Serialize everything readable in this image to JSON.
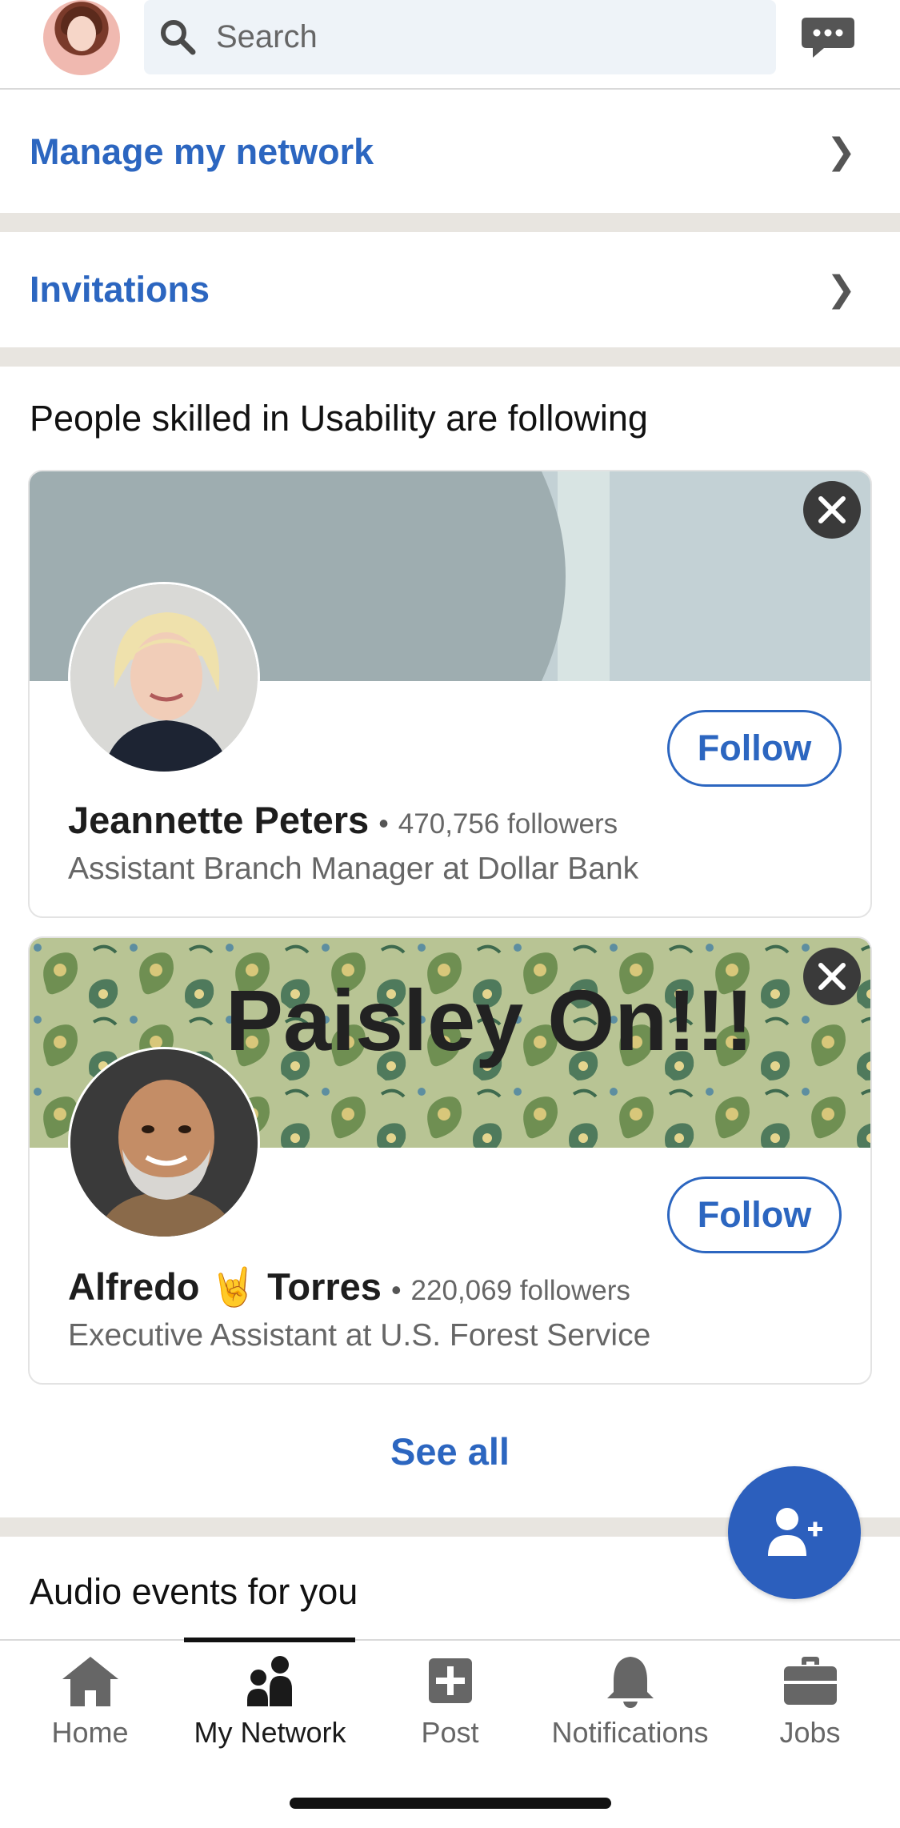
{
  "header": {
    "search_placeholder": "Search"
  },
  "rows": {
    "manage_network": "Manage my network",
    "invitations": "Invitations",
    "chevron": "❯"
  },
  "suggestions": {
    "title": "People skilled in Usability are following",
    "cards": [
      {
        "name": "Jeannette Peters",
        "followers": "470,756 followers",
        "headline": "Assistant Branch Manager at Dollar Bank",
        "follow_label": "Follow"
      },
      {
        "name": "Alfredo 🤘 Torres",
        "followers": "220,069 followers",
        "headline": "Executive Assistant at U.S. Forest Service",
        "follow_label": "Follow",
        "banner_text": "Paisley On!!!"
      }
    ],
    "see_all": "See all"
  },
  "audio_events": {
    "title": "Audio events for you"
  },
  "bottom_nav": {
    "items": [
      {
        "label": "Home",
        "icon": "home-icon"
      },
      {
        "label": "My Network",
        "icon": "my-network-icon",
        "active": true
      },
      {
        "label": "Post",
        "icon": "post-icon"
      },
      {
        "label": "Notifications",
        "icon": "bell-icon"
      },
      {
        "label": "Jobs",
        "icon": "briefcase-icon"
      }
    ]
  },
  "colors": {
    "accent": "#2c66c0",
    "fab": "#2c5fbd",
    "divider": "#e8e5e0"
  }
}
